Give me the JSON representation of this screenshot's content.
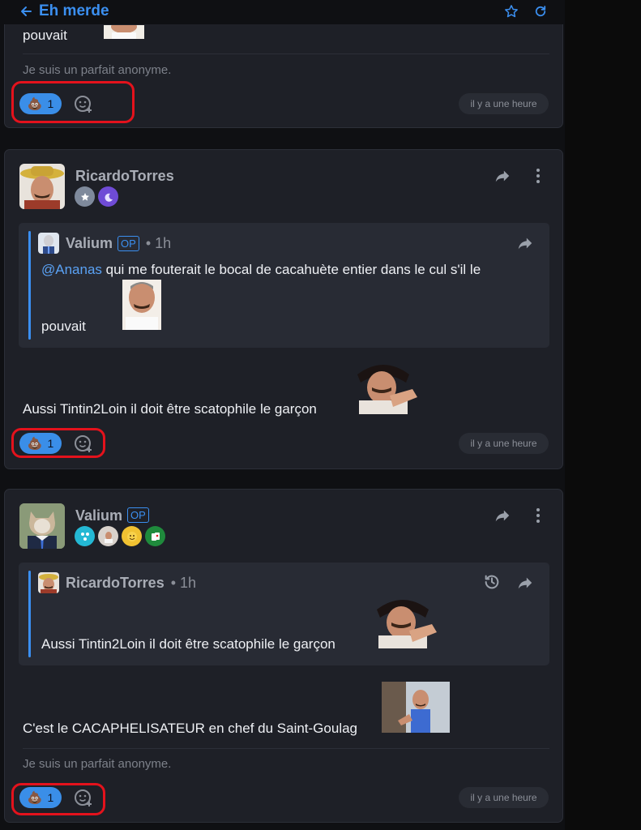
{
  "header": {
    "title": "Eh merde"
  },
  "post1": {
    "partial_text": "pouvait",
    "signature": "Je suis un parfait anonyme.",
    "reaction_count": "1",
    "time": "il y a une heure"
  },
  "post2": {
    "author": "RicardoTorres",
    "quote": {
      "author": "Valium",
      "op": "OP",
      "time": "• 1h",
      "mention": "@Ananas",
      "line1": " qui me fouterait le bocal de cacahuète entier dans le cul s'il le",
      "line2": "pouvait"
    },
    "text": "Aussi Tintin2Loin il doit être scatophile le garçon",
    "reaction_count": "1",
    "time": "il y a une heure"
  },
  "post3": {
    "author": "Valium",
    "op": "OP",
    "quote": {
      "author": "RicardoTorres",
      "time": "• 1h",
      "text": "Aussi Tintin2Loin il doit être scatophile le garçon"
    },
    "text": "C'est le CACAPHELISATEUR en chef du Saint-Goulag",
    "signature": "Je suis un parfait anonyme.",
    "reaction_count": "1",
    "time": "il y a une heure"
  },
  "colors": {
    "accent": "#3b8ff0",
    "card": "#1e2027",
    "quote_bg": "#282b34",
    "highlight": "#e4121c"
  },
  "icons": [
    "back-arrow-icon",
    "star-icon",
    "refresh-icon",
    "share-icon",
    "more-icon",
    "history-icon",
    "poop-emoji-icon",
    "add-reaction-icon"
  ]
}
